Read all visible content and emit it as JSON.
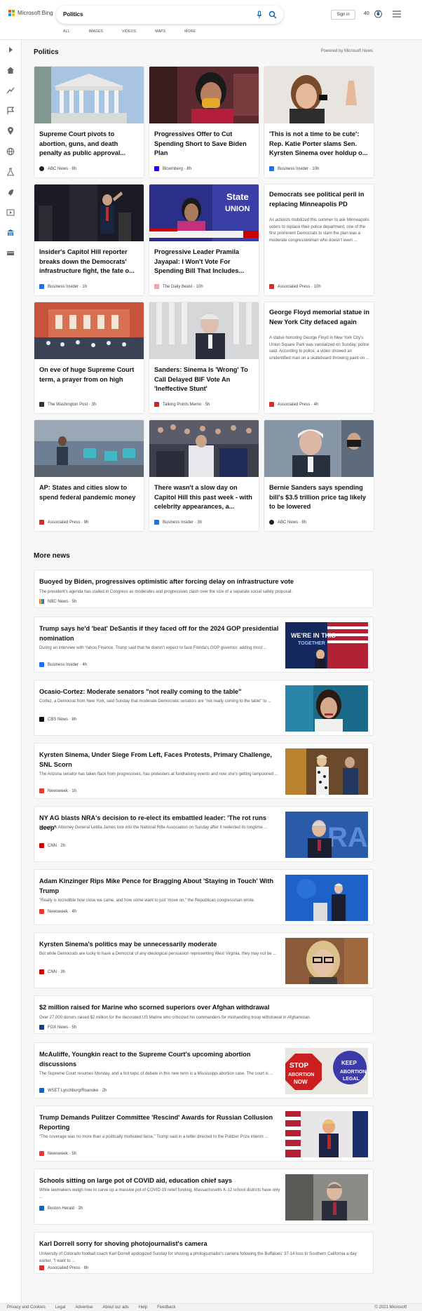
{
  "header": {
    "logo_text": "Microsoft Bing",
    "query": "Politics",
    "tabs": [
      "ALL",
      "IMAGES",
      "VIDEOS",
      "MAPS",
      "MORE"
    ],
    "signin": "Sign in",
    "points": "40"
  },
  "section": {
    "title": "Politics",
    "powered": "Powered by Microsoft News"
  },
  "cards": [
    {
      "title": "Supreme Court pivots to abortion, guns, and death penalty as public approval...",
      "source": "ABC News · 8h",
      "src_color": "#222"
    },
    {
      "title": "Progressives Offer to Cut Spending Short to Save Biden Plan",
      "source": "Bloomberg · 8h",
      "src_color": "#2b00f7"
    },
    {
      "title": "'This is not a time to be cute': Rep. Katie Porter slams Sen. Kyrsten Sinema over holdup o...",
      "source": "Business Insider · 10h",
      "src_color": "#1a73e8"
    },
    {
      "title": "Insider's Capitol Hill reporter breaks down the Democrats' infrastructure fight, the fate o...",
      "source": "Business Insider · 1h",
      "src_color": "#1a73e8"
    },
    {
      "title": "Progressive Leader Pramila Jayapal: I Won't Vote For Spending Bill That Includes...",
      "source": "The Daily Beast · 10h",
      "src_color": "#f4a4a4"
    },
    {
      "title": "Democrats see political peril in replacing Minneapolis PD",
      "desc": "As activists mobilized this summer to ask Minneapolis voters to replace their police department, one of the first prominent Democrats to slam the plan was a moderate congresswoman who doesn't even ...",
      "source": "Associated Press · 10h",
      "src_color": "#d32f2f"
    },
    {
      "title": "On eve of huge Supreme Court term, a prayer from on high",
      "source": "The Washington Post · 3h",
      "src_color": "#333"
    },
    {
      "title": "Sanders: Sinema Is 'Wrong' To Call Delayed BIF Vote An 'Ineffective Stunt'",
      "source": "Talking Points Memo · 5h",
      "src_color": "#c62828"
    },
    {
      "title": "George Floyd memorial statue in New York City defaced again",
      "desc": "A statue honoring George Floyd in New York City's Union Square Park was vandalized on Sunday, police said. According to police, a video showed an unidentified man on a skateboard throwing paint on ...",
      "source": "Associated Press · 4h",
      "src_color": "#d32f2f"
    },
    {
      "title": "AP: States and cities slow to spend federal pandemic money",
      "source": "Associated Press · 9h",
      "src_color": "#d32f2f"
    },
    {
      "title": "There wasn't a slow day on Capitol Hill this past week - with celebrity appearances, a...",
      "source": "Business Insider · 3h",
      "src_color": "#1a73e8"
    },
    {
      "title": "Bernie Sanders says spending bill's $3.5 trillion price tag likely to be lowered",
      "source": "ABC News · 8h",
      "src_color": "#222"
    }
  ],
  "more_title": "More news",
  "news": [
    {
      "title": "Buoyed by Biden, progressives optimistic after forcing delay on infrastructure vote",
      "desc": "The president's agenda has stalled in Congress as moderates and progressives clash over the size of a separate social safety proposal.",
      "source": "NBC News · 5h",
      "src_color": "#333"
    },
    {
      "title": "Trump says he'd 'beat' DeSantis if they faced off for the 2024 GOP presidential nomination",
      "desc": "During an interview with Yahoo Finance, Trump said that he doesn't expect to face Florida's GOP governor, adding most ...",
      "source": "Business Insider · 4h",
      "src_color": "#1a73e8"
    },
    {
      "title": "Ocasio-Cortez: Moderate senators \"not really coming to the table\"",
      "desc": "Cortez, a Democrat from New York, said Sunday that moderate Democratic senators are \"not really coming to the table\" to ...",
      "source": "CBS News · 8h",
      "src_color": "#111"
    },
    {
      "title": "Kyrsten Sinema, Under Siege From Left, Faces Protests, Primary Challenge, SNL Scorn",
      "desc": "The Arizona senator has taken flack from progressives, has protesters at fundraising events and now she's getting lampooned ...",
      "source": "Newsweek · 1h",
      "src_color": "#e53935"
    },
    {
      "title": "NY AG blasts NRA's decision to re-elect its embattled leader: 'The rot runs deep'",
      "desc": "New York Attorney General Letitia James tore into the National Rifle Association on Sunday after it reelected its longtime ...",
      "source": "CNN · 2h",
      "src_color": "#cc0000"
    },
    {
      "title": "Adam Kinzinger Rips Mike Pence for Bragging About 'Staying in Touch' With Trump",
      "desc": "\"Really is incredible how close we came, and how some want to just 'move on,\" the Republican congressman wrote.",
      "source": "Newsweek · 4h",
      "src_color": "#e53935"
    },
    {
      "title": "Kyrsten Sinema's politics may be unnecessarily moderate",
      "desc": "But while Democrats are lucky to have a Democrat of any ideological persuasion representing West Virginia, they may not be ...",
      "source": "CNN · 3h",
      "src_color": "#cc0000"
    },
    {
      "title": "$2 million raised for Marine who scorned superiors over Afghan withdrawal",
      "desc": "Over 27,000 donors raised $2 million for the decorated US Marine who criticized his commanders for mishandling troop withdrawal in Afghanistan.",
      "source": "FOX News · 5h",
      "src_color": "#1a3c8c"
    },
    {
      "title": "McAuliffe, Youngkin react to the Supreme Court's upcoming abortion discussions",
      "desc": "The Supreme Court resumes Monday, and a hot topic of debate in this new term is a Mississippi abortion case. The court is ...",
      "source": "WSET Lynchburg/Roanoke · 2h",
      "src_color": "#1565c0"
    },
    {
      "title": "Trump Demands Pulitzer Committee 'Rescind' Awards for Russian Collusion Reporting",
      "desc": "\"The coverage was no more than a politically motivated farce,\" Trump said in a letter directed to the Pulitzer Prize interim ...",
      "source": "Newsweek · 5h",
      "src_color": "#e53935"
    },
    {
      "title": "Schools sitting on large pot of COVID aid, education chief says",
      "desc": "While lawmakers weigh how to carve up a massive pot of COVID-19 relief funding, Massachusetts K-12 school districts have only ...",
      "source": "Boston Herald · 3h",
      "src_color": "#1565c0"
    },
    {
      "title": "Karl Dorrell sorry for shoving photojournalist's camera",
      "desc": "University of Colorado football coach Karl Dorrell apologized Sunday for shoving a photojournalist's camera following the Buffaloes' 37-14 loss to Southern California a day earlier. \"I want to ...",
      "source": "Associated Press · 6h",
      "src_color": "#d32f2f"
    }
  ],
  "footer": {
    "links": [
      "Privacy and Cookies",
      "Legal",
      "Advertise",
      "About our ads",
      "Help",
      "Feedback"
    ],
    "copyright": "© 2021 Microsoft"
  }
}
